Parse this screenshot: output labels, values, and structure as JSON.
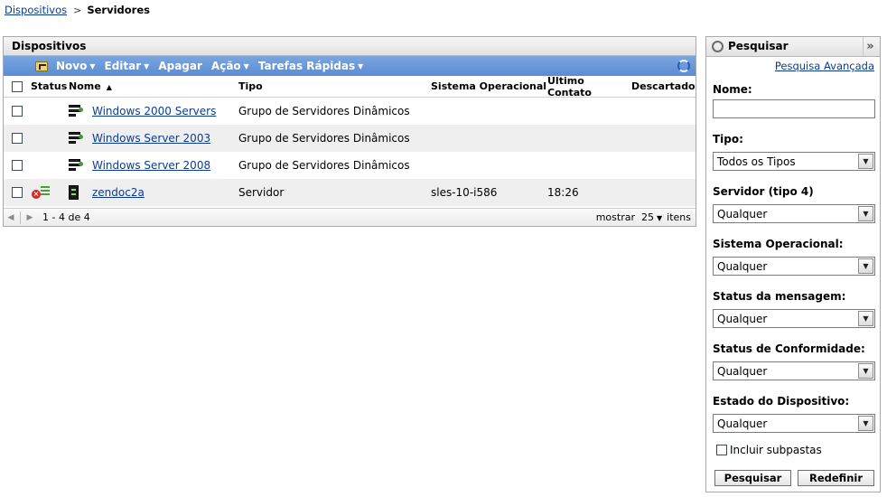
{
  "breadcrumb": {
    "parent": "Dispositivos",
    "separator": ">",
    "current": "Servidores"
  },
  "devices_panel": {
    "title": "Dispositivos",
    "toolbar": {
      "novo": "Novo",
      "editar": "Editar",
      "apagar": "Apagar",
      "acao": "Ação",
      "tarefas": "Tarefas Rápidas"
    },
    "columns": {
      "status": "Status",
      "nome": "Nome",
      "tipo": "Tipo",
      "so": "Sistema Operacional",
      "ultimo": "Último Contato",
      "descartado": "Descartado"
    },
    "rows": [
      {
        "name": "Windows 2000 Servers",
        "type": "Grupo de Servidores Dinâmicos",
        "os": "",
        "last_contact": ""
      },
      {
        "name": "Windows Server 2003",
        "type": "Grupo de Servidores Dinâmicos",
        "os": "",
        "last_contact": ""
      },
      {
        "name": "Windows Server 2008",
        "type": "Grupo de Servidores Dinâmicos",
        "os": "",
        "last_contact": ""
      },
      {
        "name": "zendoc2a",
        "type": "Servidor",
        "os": "sles-10-i586",
        "last_contact": "18:26"
      }
    ],
    "pager": {
      "range": "1 - 4 de 4",
      "show_label": "mostrar",
      "page_size": "25",
      "items_label": "itens"
    }
  },
  "search_panel": {
    "title": "Pesquisar",
    "advanced_link": "Pesquisa Avançada",
    "name_label": "Nome:",
    "name_value": "",
    "tipo_label": "Tipo:",
    "tipo_value": "Todos os Tipos",
    "servidor_label": "Servidor (tipo 4)",
    "servidor_value": "Qualquer",
    "so_label": "Sistema Operacional:",
    "so_value": "Qualquer",
    "msg_label": "Status da mensagem:",
    "msg_value": "Qualquer",
    "conf_label": "Status de Conformidade:",
    "conf_value": "Qualquer",
    "estado_label": "Estado do Dispositivo:",
    "estado_value": "Qualquer",
    "subfolders_label": "Incluir subpastas",
    "search_button": "Pesquisar",
    "reset_button": "Redefinir"
  },
  "colors": {
    "toolbar": "#5b8bd3",
    "link": "#0c3b97",
    "row_alt": "#efefef"
  }
}
